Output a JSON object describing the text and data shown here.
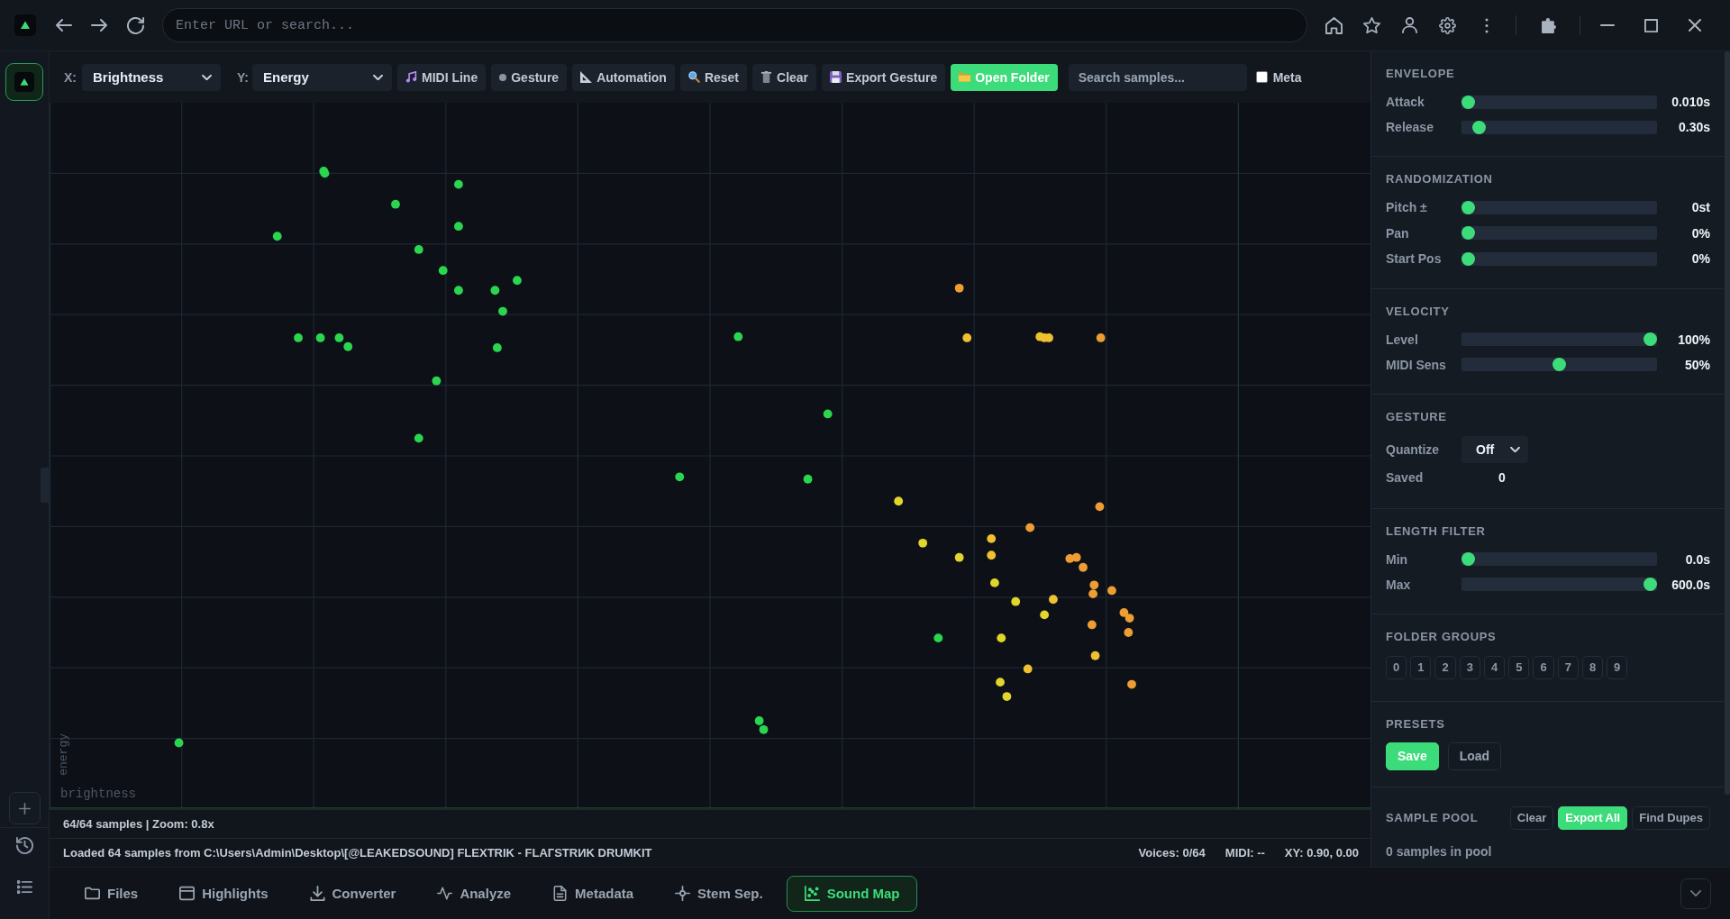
{
  "browser": {
    "url_placeholder": "Enter URL or search..."
  },
  "toolbar": {
    "x_label": "X:",
    "x_axis": "Brightness",
    "y_label": "Y:",
    "y_axis": "Energy",
    "buttons": [
      {
        "label": "MIDI Line",
        "primary": false
      },
      {
        "label": "Gesture",
        "primary": false
      },
      {
        "label": "Automation",
        "primary": false
      },
      {
        "label": "Reset",
        "primary": false
      },
      {
        "label": "Clear",
        "primary": false
      },
      {
        "label": "Export Gesture",
        "primary": false
      },
      {
        "label": "Open Folder",
        "primary": true
      }
    ],
    "search_placeholder": "Search samples...",
    "meta": {
      "label": "Meta",
      "checked": false
    }
  },
  "sound_map": {
    "x_axis_label": "brightness",
    "y_axis_label": "energy"
  },
  "status": {
    "summary": "64/64 samples | Zoom: 0.8x",
    "message": "Loaded 64 samples from C:\\Users\\Admin\\Desktop\\[@LEAKEDSOUND] FLEXTRIK - FLAГSTRИK DRUMKIT",
    "voices": "Voices: 0/64",
    "midi": "MIDI: --",
    "xy": "XY: 0.90, 0.00"
  },
  "panel": {
    "sections": [
      {
        "title": "ENVELOPE",
        "kind": "sliders",
        "rows": [
          {
            "label": "Attack",
            "level": 0,
            "reading": "0.010s"
          },
          {
            "label": "Release",
            "level": 0.06,
            "reading": "0.30s"
          }
        ]
      },
      {
        "title": "RANDOMIZATION",
        "kind": "sliders",
        "rows": [
          {
            "label": "Pitch ±",
            "level": 0,
            "reading": "0st"
          },
          {
            "label": "Pan",
            "level": 0,
            "reading": "0%"
          },
          {
            "label": "Start Pos",
            "level": 0,
            "reading": "0%"
          }
        ]
      },
      {
        "title": "VELOCITY",
        "kind": "sliders",
        "rows": [
          {
            "label": "Level",
            "level": 1,
            "reading": "100%"
          },
          {
            "label": "MIDI Sens",
            "level": 0.5,
            "reading": "50%"
          }
        ]
      },
      {
        "title": "GESTURE",
        "kind": "fields",
        "rows": [
          {
            "label": "Quantize",
            "kind": "dropdown",
            "value": "Off"
          },
          {
            "label": "Saved",
            "kind": "value",
            "value": "0"
          }
        ]
      },
      {
        "title": "LENGTH FILTER",
        "kind": "sliders",
        "rows": [
          {
            "label": "Min",
            "level": 0,
            "reading": "0.0s"
          },
          {
            "label": "Max",
            "level": 1,
            "reading": "600.0s"
          }
        ]
      },
      {
        "title": "FOLDER GROUPS",
        "kind": "chips",
        "chips": [
          {
            "label": "0",
            "selected": false
          },
          {
            "label": "1",
            "selected": false
          },
          {
            "label": "2",
            "selected": false
          },
          {
            "label": "3",
            "selected": false
          },
          {
            "label": "4",
            "selected": false
          },
          {
            "label": "5",
            "selected": false
          },
          {
            "label": "6",
            "selected": false
          },
          {
            "label": "7",
            "selected": false
          },
          {
            "label": "8",
            "selected": false
          },
          {
            "label": "9",
            "selected": false
          }
        ]
      },
      {
        "title": "PRESETS",
        "kind": "buttons",
        "buttons": [
          {
            "label": "Save",
            "primary": true
          },
          {
            "label": "Load",
            "primary": false
          }
        ]
      },
      {
        "title": "SAMPLE POOL",
        "kind": "pool",
        "buttons": [
          {
            "label": "Clear",
            "primary": false
          },
          {
            "label": "Export All",
            "primary": true
          },
          {
            "label": "Find Dupes",
            "primary": false
          }
        ],
        "note": "0 samples in pool"
      }
    ]
  },
  "bottom_tabs": [
    {
      "label": "Files",
      "selected": false
    },
    {
      "label": "Highlights",
      "selected": false
    },
    {
      "label": "Converter",
      "selected": false
    },
    {
      "label": "Analyze",
      "selected": false
    },
    {
      "label": "Metadata",
      "selected": false
    },
    {
      "label": "Stem Sep.",
      "selected": false
    },
    {
      "label": "Sound Map",
      "selected": true
    }
  ]
}
